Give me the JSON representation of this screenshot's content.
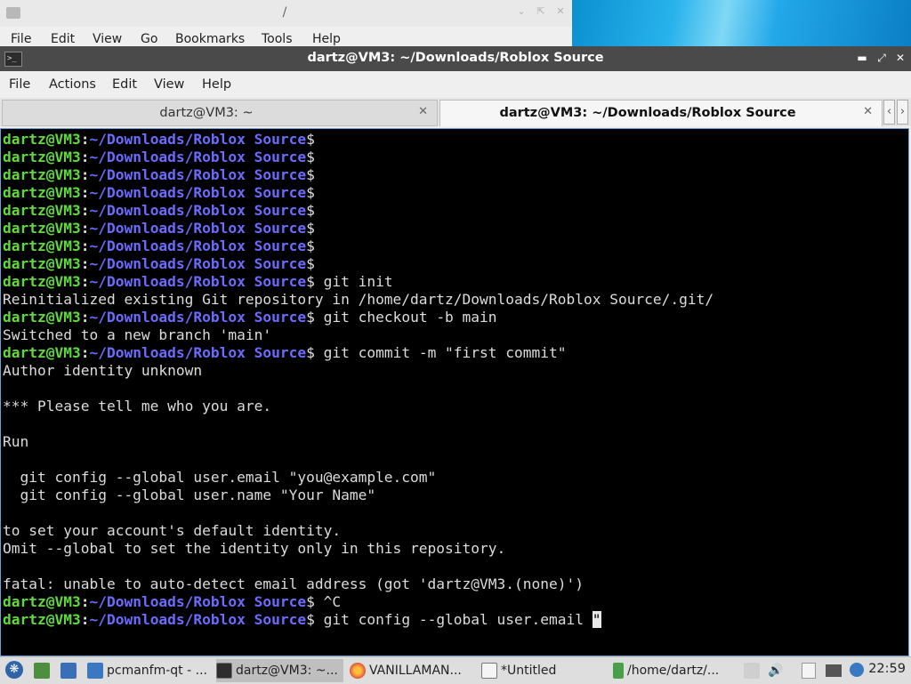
{
  "background_window": {
    "title": "/",
    "menu": [
      "File",
      "Edit",
      "View",
      "Go",
      "Bookmarks",
      "Tools",
      "Help"
    ]
  },
  "terminal_window": {
    "title": "dartz@VM3: ~/Downloads/Roblox Source",
    "menu": [
      "File",
      "Actions",
      "Edit",
      "View",
      "Help"
    ],
    "tabs": [
      {
        "label": "dartz@VM3: ~",
        "active": false
      },
      {
        "label": "dartz@VM3: ~/Downloads/Roblox Source",
        "active": true
      }
    ],
    "prompt": {
      "user": "dartz@VM3",
      "colon": ":",
      "path": "~/Downloads/Roblox Source",
      "dollar": "$"
    },
    "lines": [
      {
        "type": "prompt",
        "cmd": ""
      },
      {
        "type": "prompt",
        "cmd": ""
      },
      {
        "type": "prompt",
        "cmd": ""
      },
      {
        "type": "prompt",
        "cmd": ""
      },
      {
        "type": "prompt",
        "cmd": ""
      },
      {
        "type": "prompt",
        "cmd": ""
      },
      {
        "type": "prompt",
        "cmd": ""
      },
      {
        "type": "prompt",
        "cmd": ""
      },
      {
        "type": "prompt",
        "cmd": " git init"
      },
      {
        "type": "output",
        "text": "Reinitialized existing Git repository in /home/dartz/Downloads/Roblox Source/.git/"
      },
      {
        "type": "prompt",
        "cmd": " git checkout -b main"
      },
      {
        "type": "output",
        "text": "Switched to a new branch 'main'"
      },
      {
        "type": "prompt",
        "cmd": " git commit -m \"first commit\""
      },
      {
        "type": "output",
        "text": "Author identity unknown"
      },
      {
        "type": "output",
        "text": ""
      },
      {
        "type": "output",
        "text": "*** Please tell me who you are."
      },
      {
        "type": "output",
        "text": ""
      },
      {
        "type": "output",
        "text": "Run"
      },
      {
        "type": "output",
        "text": ""
      },
      {
        "type": "output",
        "text": "  git config --global user.email \"you@example.com\""
      },
      {
        "type": "output",
        "text": "  git config --global user.name \"Your Name\""
      },
      {
        "type": "output",
        "text": ""
      },
      {
        "type": "output",
        "text": "to set your account's default identity."
      },
      {
        "type": "output",
        "text": "Omit --global to set the identity only in this repository."
      },
      {
        "type": "output",
        "text": ""
      },
      {
        "type": "output",
        "text": "fatal: unable to auto-detect email address (got 'dartz@VM3.(none)')"
      },
      {
        "type": "prompt",
        "cmd": " ^C"
      },
      {
        "type": "prompt",
        "cmd": " git config --global user.email \"",
        "cursor": "\""
      }
    ]
  },
  "taskbar": {
    "tasks": [
      {
        "label": "pcmanfm-qt - ...",
        "icon": "folder-icon",
        "active": false
      },
      {
        "label": "dartz@VM3: ~...",
        "icon": "terminal-icon",
        "active": true
      },
      {
        "label": "VANILLAMAN...",
        "icon": "firefox-icon",
        "active": false
      },
      {
        "label": "*Untitled",
        "icon": "text-editor-icon",
        "active": false
      },
      {
        "label": "/home/dartz/...",
        "icon": "file-manager-icon",
        "active": false
      }
    ],
    "clock": "22:59"
  }
}
